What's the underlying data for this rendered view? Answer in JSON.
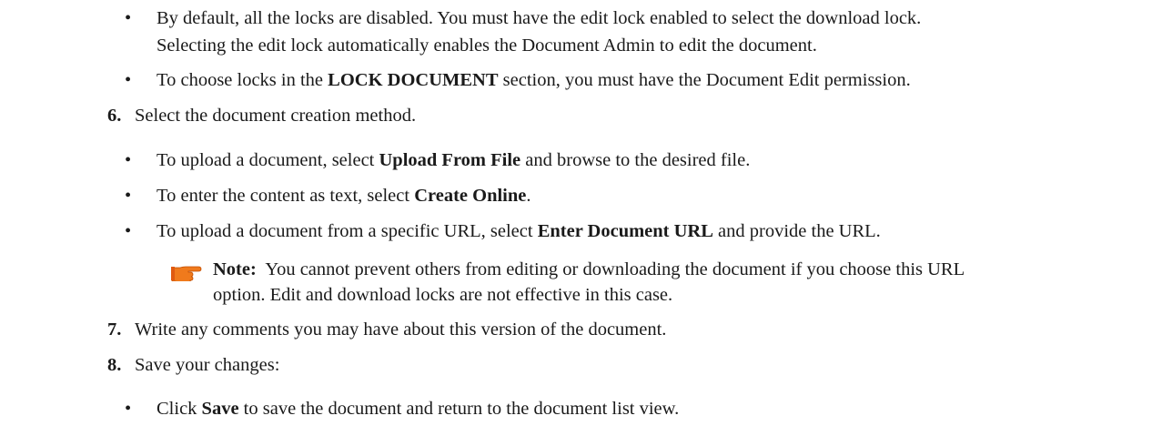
{
  "bullet_glyph": "•",
  "top_bullets": [
    {
      "line1": "By default, all the locks are disabled. You must have the edit lock enabled to select the download lock.",
      "line2": "Selecting the edit lock automatically enables the Document Admin to edit the document."
    },
    {
      "pre": "To choose locks in the ",
      "bold": "LOCK DOCUMENT",
      "post": " section, you must have the Document Edit permission."
    }
  ],
  "steps": [
    {
      "number": "6.",
      "text": "Select the document creation method.",
      "bullets": [
        {
          "pre": "To upload a document, select ",
          "bold": "Upload From File",
          "post": " and browse to the desired file."
        },
        {
          "pre": "To enter the content as text, select ",
          "bold": "Create Online",
          "post": "."
        },
        {
          "pre": "To upload a document from a specific URL, select ",
          "bold": "Enter Document URL",
          "post": " and provide the URL."
        }
      ],
      "note": {
        "label": "Note:",
        "line1": "You cannot prevent others from editing or downloading the document if you choose this URL",
        "line2": "option. Edit and download locks are not effective in this case."
      }
    },
    {
      "number": "7.",
      "text": "Write any comments you may have about this version of the document."
    },
    {
      "number": "8.",
      "text": "Save your changes:",
      "bullets": [
        {
          "pre": "Click ",
          "bold": "Save",
          "post": " to save the document and return to the document list view."
        }
      ]
    }
  ],
  "icons": {
    "note": "pointing-hand-icon",
    "note_color": "#f07a1c"
  }
}
